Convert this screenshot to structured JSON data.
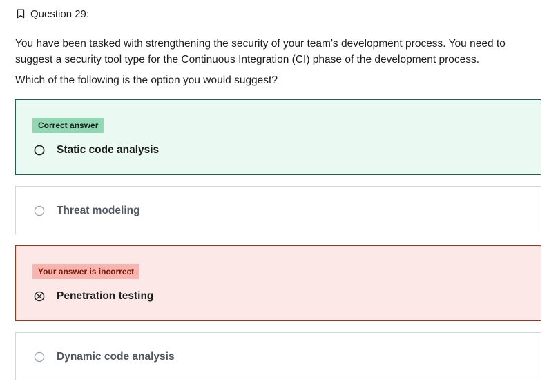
{
  "question": {
    "title": "Question 29:",
    "paragraph": "You have been tasked with strengthening the security of your team's development process. You need to suggest a security tool type for the Continuous Integration (CI) phase of the development process.",
    "prompt": "Which of the following is the option you would suggest?"
  },
  "options": [
    {
      "label": "Static code analysis",
      "badge": "Correct answer",
      "status": "correct"
    },
    {
      "label": "Threat modeling",
      "status": "neutral"
    },
    {
      "label": "Penetration testing",
      "badge": "Your answer is incorrect",
      "status": "incorrect"
    },
    {
      "label": "Dynamic code analysis",
      "status": "neutral"
    }
  ],
  "colors": {
    "correct_bg": "#ebf9f3",
    "correct_border": "#1e6055",
    "correct_badge": "#8fd8b3",
    "incorrect_bg": "#fde8e8",
    "incorrect_border": "#b32d0f",
    "incorrect_badge": "#f8b4ae"
  },
  "icons": {
    "bookmark": "bookmark-icon",
    "radio": "radio-empty-icon",
    "incorrect": "x-circle-icon"
  }
}
